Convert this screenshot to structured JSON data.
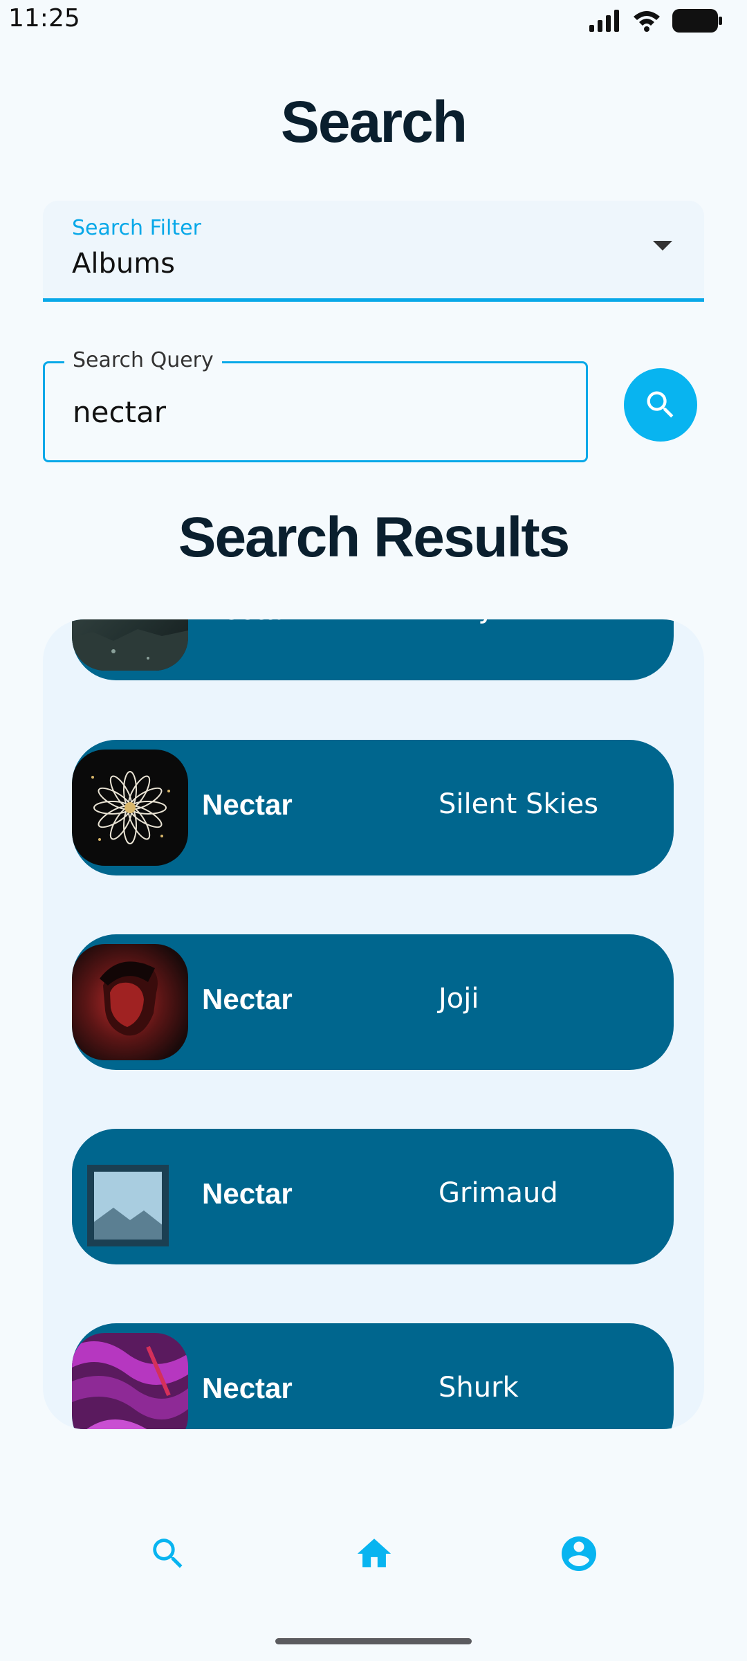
{
  "status_bar": {
    "time": "11:25",
    "icons": [
      "signal-icon",
      "wifi-icon",
      "battery-icon"
    ]
  },
  "page": {
    "title": "Search",
    "results_title": "Search Results"
  },
  "filter": {
    "label": "Search Filter",
    "value": "Albums"
  },
  "query": {
    "label": "Search Query",
    "value": "nectar"
  },
  "colors": {
    "accent": "#08b4f0",
    "result_bg": "#00668e",
    "page_bg": "#f5fafd",
    "list_bg": "#ebf5fd",
    "heading": "#0a1f2e"
  },
  "results": [
    {
      "title": "Nectar",
      "artist": "CMJ",
      "art": "dark-landscape-art"
    },
    {
      "title": "Nectar",
      "artist": "Silent Skies",
      "art": "flower-art"
    },
    {
      "title": "Nectar",
      "artist": "Joji",
      "art": "portrait-art"
    },
    {
      "title": "Nectar",
      "artist": "Grimaud",
      "art": "placeholder-image-icon"
    },
    {
      "title": "Nectar",
      "artist": "Shurk",
      "art": "purple-abstract-art"
    }
  ],
  "bottom_nav": {
    "items": [
      "search-icon",
      "home-icon",
      "account-icon"
    ]
  }
}
